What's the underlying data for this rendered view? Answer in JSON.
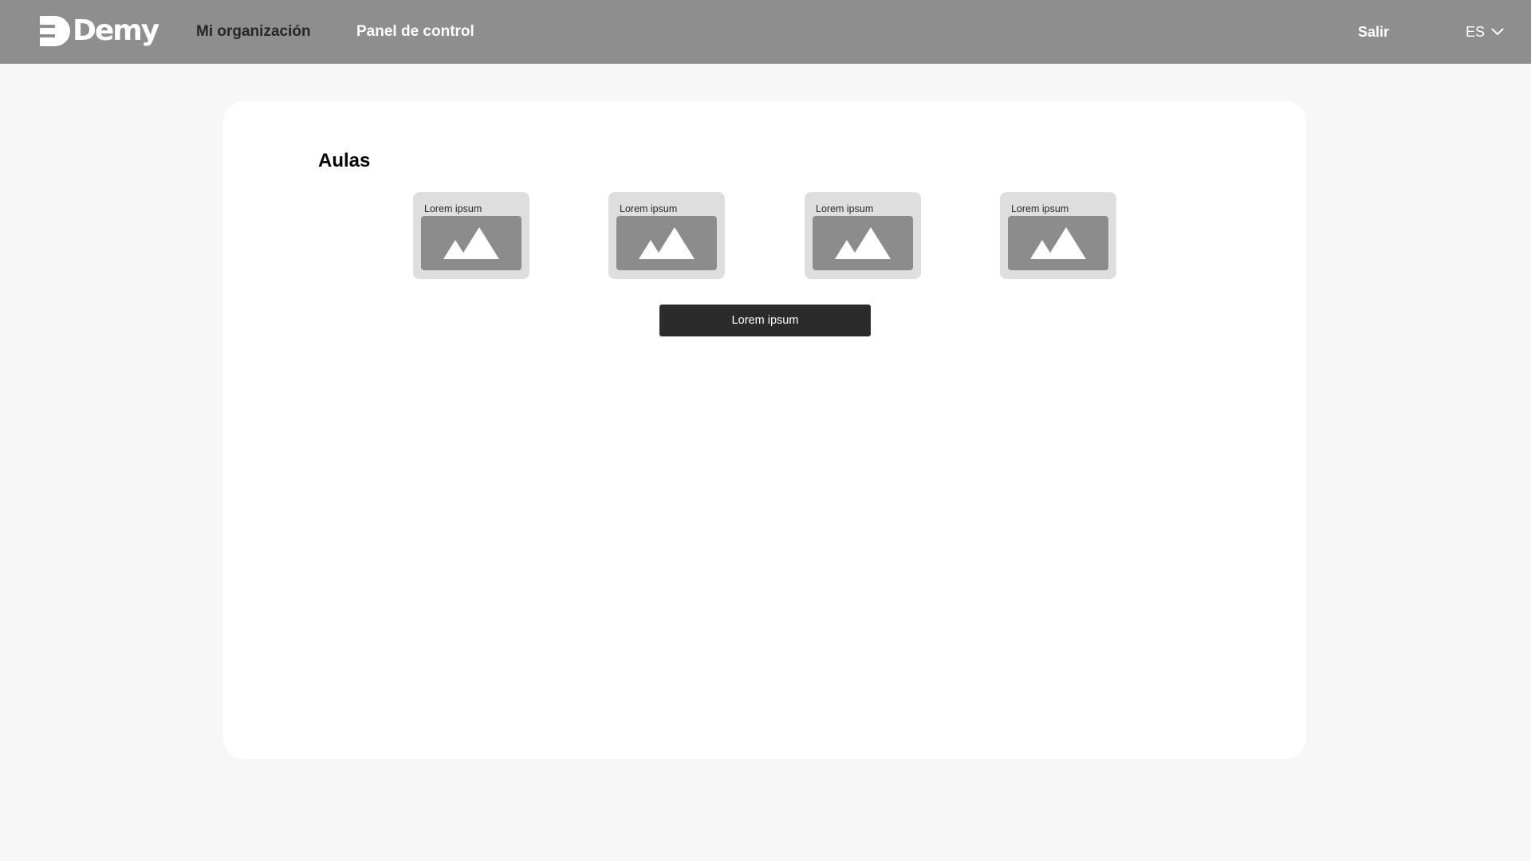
{
  "header": {
    "brand": "Demy",
    "nav": [
      {
        "label": "Mi organización",
        "active": true
      },
      {
        "label": "Panel de control",
        "active": false
      }
    ],
    "logout_label": "Salir",
    "language": "ES"
  },
  "main": {
    "title": "Aulas",
    "classrooms": [
      {
        "label": "Lorem ipsum",
        "icon": "image-placeholder-icon"
      },
      {
        "label": "Lorem ipsum",
        "icon": "image-placeholder-icon"
      },
      {
        "label": "Lorem ipsum",
        "icon": "image-placeholder-icon"
      },
      {
        "label": "Lorem ipsum",
        "icon": "image-placeholder-icon"
      }
    ],
    "button_label": "Lorem ipsum"
  },
  "colors": {
    "header_bg": "#8e8e8e",
    "page_bg": "#f7f7f7",
    "card_bg": "#ffffff",
    "tile_bg": "#dedede",
    "image_bg": "#8c8c8c",
    "button_bg": "#2b2b2b"
  }
}
